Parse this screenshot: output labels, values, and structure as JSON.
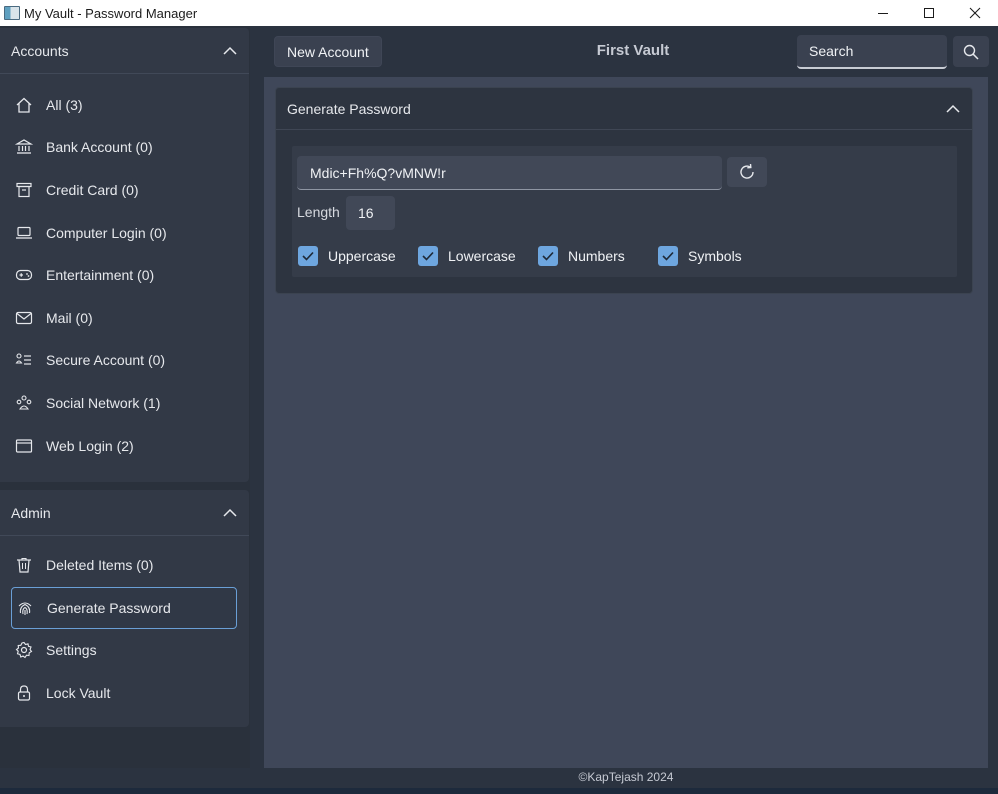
{
  "window": {
    "title": "My Vault - Password Manager"
  },
  "sidebar": {
    "accounts": {
      "header": "Accounts",
      "items": [
        {
          "label": "All (3)",
          "icon": "home-icon"
        },
        {
          "label": "Bank Account (0)",
          "icon": "bank-icon"
        },
        {
          "label": "Credit Card (0)",
          "icon": "credit-card-icon"
        },
        {
          "label": "Computer Login (0)",
          "icon": "laptop-icon"
        },
        {
          "label": "Entertainment (0)",
          "icon": "gamepad-icon"
        },
        {
          "label": "Mail (0)",
          "icon": "mail-icon"
        },
        {
          "label": "Secure Account (0)",
          "icon": "secure-list-icon"
        },
        {
          "label": "Social Network (1)",
          "icon": "social-network-icon"
        },
        {
          "label": "Web Login (2)",
          "icon": "browser-window-icon"
        }
      ]
    },
    "admin": {
      "header": "Admin",
      "items": [
        {
          "label": "Deleted Items (0)",
          "icon": "trash-icon"
        },
        {
          "label": "Generate Password",
          "icon": "fingerprint-icon",
          "active": true
        },
        {
          "label": "Settings",
          "icon": "gear-icon"
        },
        {
          "label": "Lock Vault",
          "icon": "lock-icon"
        }
      ]
    }
  },
  "topbar": {
    "new_account_label": "New Account",
    "vault_title": "First Vault",
    "search_text": "Search"
  },
  "generator": {
    "header": "Generate Password",
    "password": "Mdic+Fh%Q?vMNW!r",
    "length_label": "Length",
    "length_value": "16",
    "options": [
      {
        "label": "Uppercase",
        "checked": true
      },
      {
        "label": "Lowercase",
        "checked": true
      },
      {
        "label": "Numbers",
        "checked": true
      },
      {
        "label": "Symbols",
        "checked": true
      }
    ]
  },
  "footer": {
    "text": "©KapTejash 2024"
  },
  "colors": {
    "accent": "#6ea6df",
    "sidebar_bg": "#323946",
    "content_bg": "#3f4759"
  }
}
